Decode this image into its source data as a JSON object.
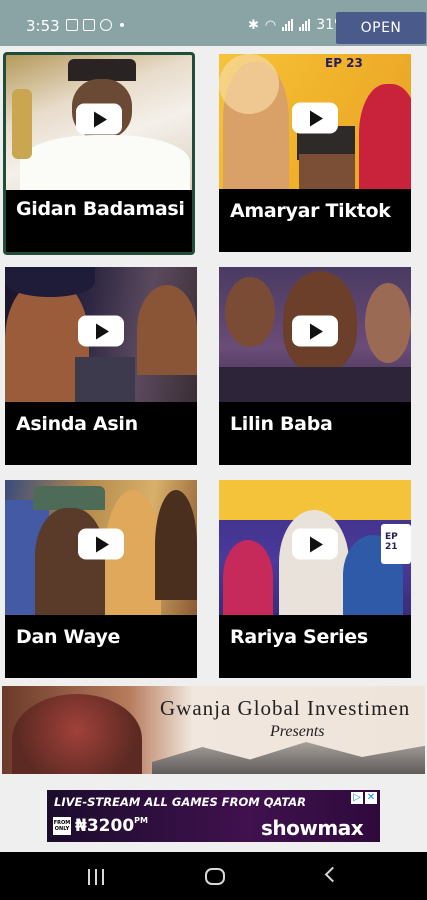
{
  "status_bar": {
    "time": "3:53",
    "battery": "31%",
    "open_label": "OPEN"
  },
  "videos": [
    {
      "title": "Gidan Badamasi",
      "thumb_icon": "video-thumbnail",
      "selected": true
    },
    {
      "title": "Amaryar Tiktok",
      "thumb_icon": "video-thumbnail",
      "badge": "EP 23"
    },
    {
      "title": "Asinda Asin",
      "thumb_icon": "video-thumbnail"
    },
    {
      "title": "Lilin Baba",
      "thumb_icon": "video-thumbnail"
    },
    {
      "title": "Dan Waye",
      "thumb_icon": "video-thumbnail"
    },
    {
      "title": "Rariya Series",
      "thumb_icon": "video-thumbnail",
      "badge": "EP 21"
    }
  ],
  "banner": {
    "title": "Gwanja Global Investimen",
    "subtitle": "Presents"
  },
  "ad": {
    "headline": "LIVE-STREAM ALL GAMES FROM QATAR",
    "price_prefix": "FROM ONLY",
    "price": "₦3200",
    "price_suffix": "PM",
    "brand": "showmax"
  },
  "nav": {
    "recents_icon": "recents-icon",
    "home_icon": "home-icon",
    "back_icon": "back-icon"
  },
  "colors": {
    "status_bar": "#8aa3a5",
    "open_badge": "#4a5a8a",
    "card_bg": "#000000",
    "selected_border": "#1f4d3a"
  }
}
